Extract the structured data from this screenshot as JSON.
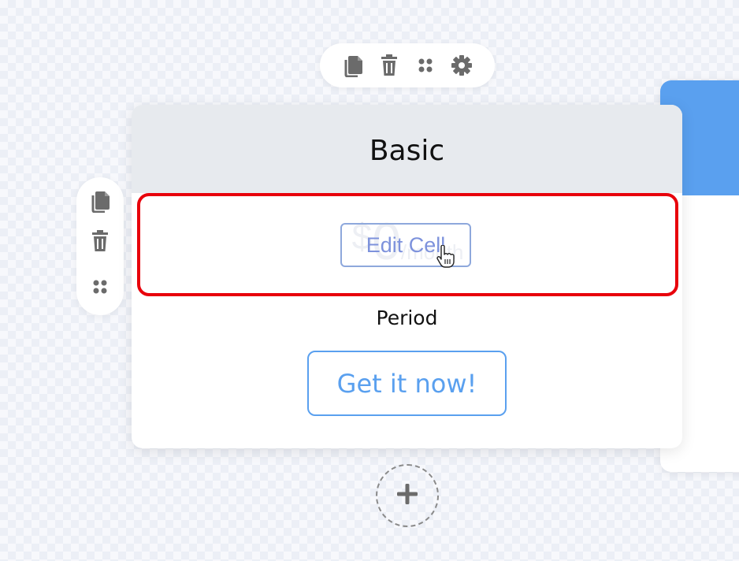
{
  "toolbar": {
    "icons": [
      "copy-icon",
      "trash-icon",
      "drag-handle-icon",
      "gear-icon"
    ],
    "icon_color": "#6b6b6b"
  },
  "side_toolbar": {
    "icons": [
      "copy-icon",
      "trash-icon",
      "drag-handle-icon"
    ]
  },
  "card": {
    "title": "Basic",
    "header_color": "#e7eaee",
    "price": {
      "currency": "$",
      "amount": "0",
      "period": "/month"
    },
    "edit_cell_label": "Edit Cell",
    "period_label": "Period",
    "cta_label": "Get it now!",
    "accent": "#5aa0ef",
    "selection_color": "#e8000b"
  },
  "next_card": {
    "header_color": "#5aa0ef"
  },
  "add_button": {
    "icon": "plus-icon"
  }
}
